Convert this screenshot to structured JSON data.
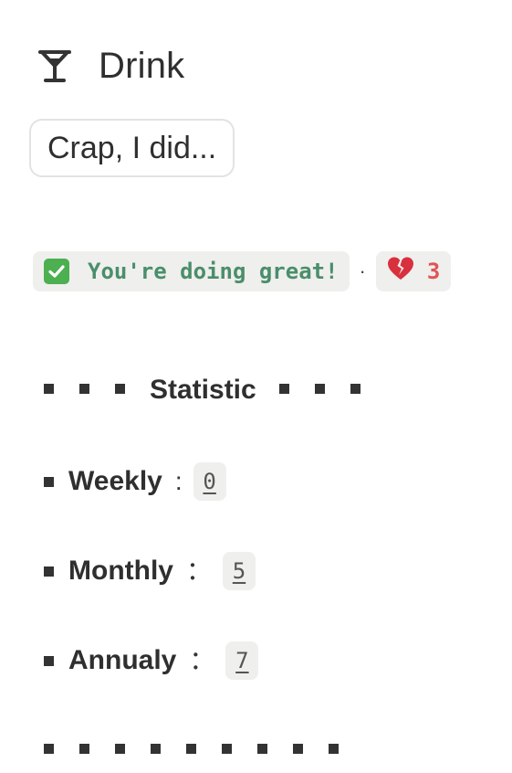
{
  "header": {
    "title": "Drink",
    "icon": "cocktail-glass-icon"
  },
  "action_button": {
    "label": "Crap, I did..."
  },
  "status": {
    "check_icon": "check-mark-icon",
    "message": "You're doing great!",
    "separator": "·",
    "heart_icon": "broken-heart-icon",
    "heart_count": "3"
  },
  "statistics": {
    "title": "Statistic",
    "rows": [
      {
        "label": "Weekly",
        "colon": ":",
        "value": "0"
      },
      {
        "label": "Monthly",
        "colon": "：",
        "value": "5"
      },
      {
        "label": "Annualy",
        "colon": "：",
        "value": "7"
      }
    ]
  },
  "colors": {
    "text": "#2f2f2f",
    "chip_background": "#efefed",
    "success_text": "#4a8e6b",
    "check_green": "#4caf50",
    "heart_red": "#e05555"
  }
}
